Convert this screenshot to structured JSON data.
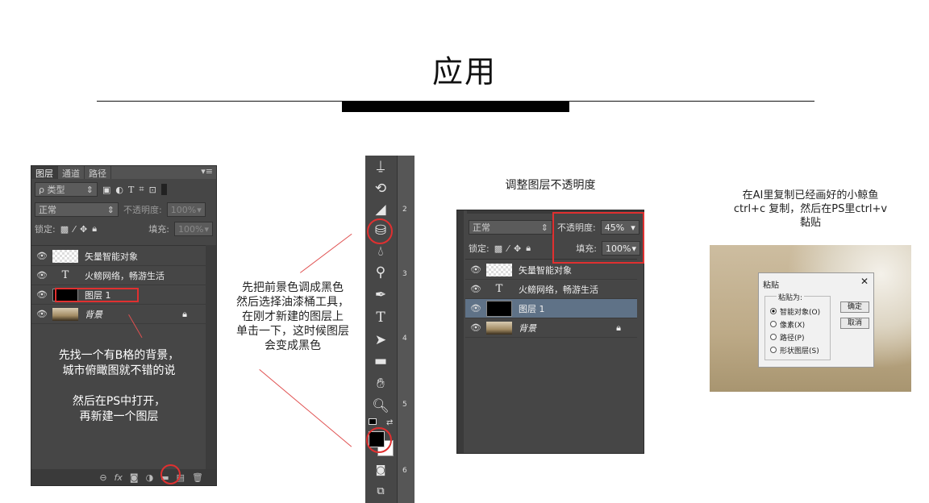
{
  "page": {
    "title": "应用"
  },
  "panel1": {
    "tabs": [
      "图层",
      "通道",
      "路径"
    ],
    "filter_label": "ρ 类型",
    "filter_icons": [
      "image-icon",
      "circle-half-icon",
      "text-icon",
      "transform-icon",
      "smart-object-icon"
    ],
    "blend_mode": "正常",
    "opacity_label": "不透明度:",
    "opacity_value": "100%",
    "lock_label": "锁定:",
    "fill_label": "填充:",
    "fill_value": "100%",
    "layers": [
      {
        "name": "矢量智能对象",
        "thumb": "checker"
      },
      {
        "name": "火鳑网络，畅游生活",
        "thumb": "text"
      },
      {
        "name": "图层 1",
        "thumb": "black"
      },
      {
        "name": "背景",
        "thumb": "city",
        "locked": true
      }
    ],
    "note": "先找一个有B格的背景，\n城市俯瞰图就不错的说\n\n然后在PS中打开，\n再新建一个图层",
    "footer_icons": [
      "link-icon",
      "fx-icon",
      "mask-icon",
      "adjustment-icon",
      "folder-icon",
      "new-layer-icon",
      "trash-icon"
    ]
  },
  "panel2": {
    "caption": "先把前景色调成黑色\n然后选择油漆桶工具，\n在刚才新建的图层上\n单击一下，这时候图层\n会变成黑色",
    "tools": [
      "stamp-icon",
      "history-brush-icon",
      "eraser-icon",
      "paint-bucket-icon",
      "blur-icon",
      "dodge-icon",
      "pen-icon",
      "type-icon",
      "path-select-icon",
      "rectangle-icon",
      "hand-icon",
      "zoom-icon"
    ],
    "ruler_numbers": [
      "2",
      "3",
      "4",
      "5",
      "6"
    ]
  },
  "panel3": {
    "caption": "调整图层不透明度",
    "blend_mode": "正常",
    "opacity_label": "不透明度:",
    "opacity_value": "45%",
    "lock_label": "锁定:",
    "fill_label": "填充:",
    "fill_value": "100%",
    "layers": [
      {
        "name": "矢量智能对象"
      },
      {
        "name": "火鳑网络，畅游生活"
      },
      {
        "name": "图层 1"
      },
      {
        "name": "背景"
      }
    ]
  },
  "panel4": {
    "caption": "在AI里复制已经画好的小鲸鱼\nctrl+c 复制，然后在PS里ctrl+v\n黏贴",
    "dialog_title": "粘贴",
    "paste_as_label": "粘贴为:",
    "options": [
      "智能对象(O)",
      "像素(X)",
      "路径(P)",
      "形状图层(S)"
    ],
    "ok_label": "确定",
    "cancel_label": "取消"
  },
  "colors": {
    "accent": "#e03030",
    "panel_bg": "#464646"
  }
}
